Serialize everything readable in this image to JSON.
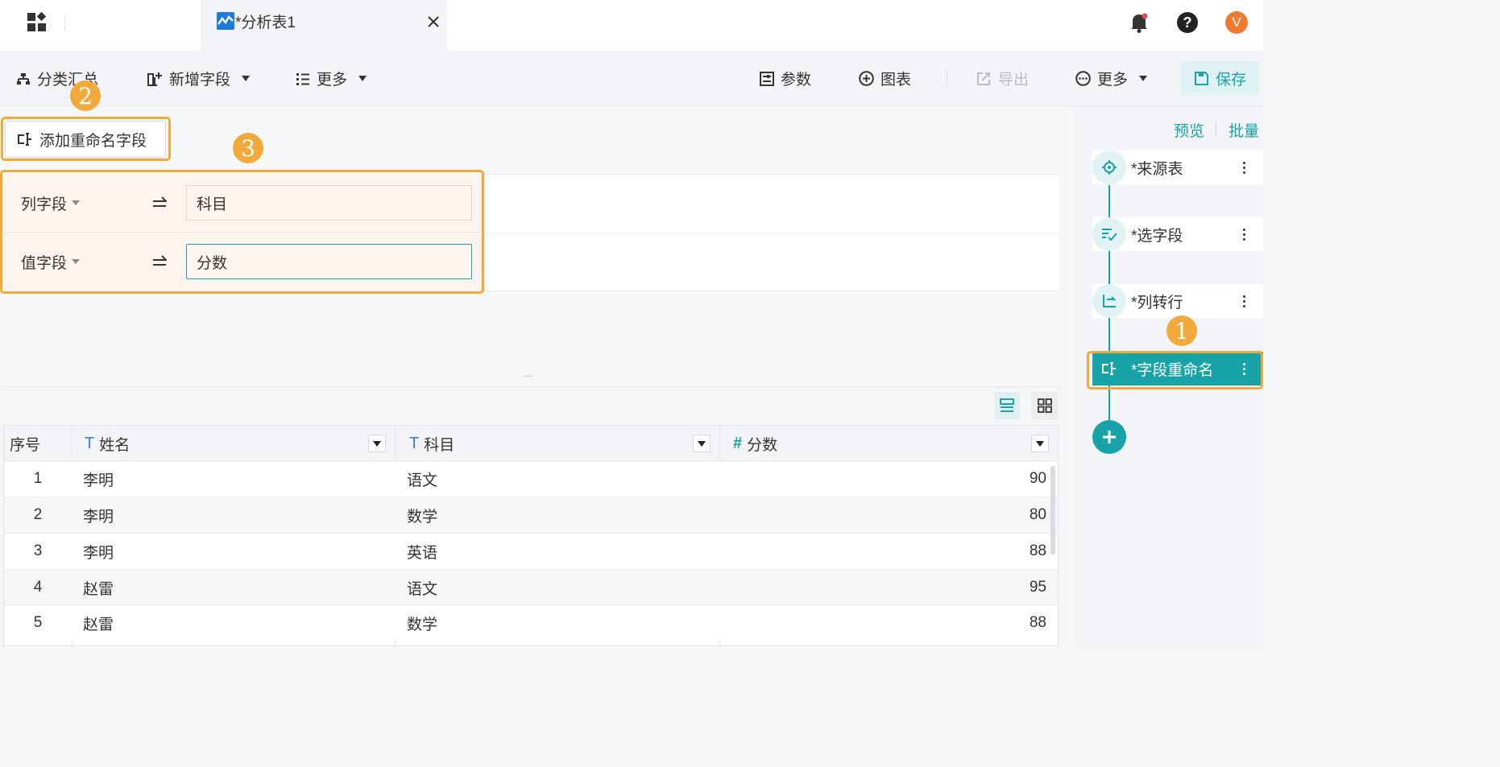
{
  "tab": {
    "title": "*分析表1"
  },
  "header": {
    "avatar_letter": "V"
  },
  "toolbar": {
    "group_summary": "分类汇总",
    "add_field": "新增字段",
    "more_left": "更多",
    "params": "参数",
    "chart": "图表",
    "export": "导出",
    "more_right": "更多",
    "save": "保存"
  },
  "editor": {
    "add_rename_button": "添加重命名字段",
    "rows": [
      {
        "field": "列字段",
        "new_name": "科目"
      },
      {
        "field": "值字段",
        "new_name": "分数"
      }
    ],
    "splitter": "..."
  },
  "steps_panel": {
    "preview": "预览",
    "batch": "批量",
    "steps": [
      {
        "label": "*来源表",
        "icon": "target-icon"
      },
      {
        "label": "*选字段",
        "icon": "select-fields-icon"
      },
      {
        "label": "*列转行",
        "icon": "unpivot-icon"
      },
      {
        "label": "*字段重命名",
        "icon": "rename-field-icon",
        "active": true
      }
    ]
  },
  "badges": {
    "b1": "1",
    "b2": "2",
    "b3": "3"
  },
  "grid": {
    "columns": [
      {
        "label": "序号",
        "type": ""
      },
      {
        "label": "姓名",
        "type": "T"
      },
      {
        "label": "科目",
        "type": "T"
      },
      {
        "label": "分数",
        "type": "#"
      }
    ],
    "rows": [
      {
        "idx": "1",
        "name": "李明",
        "subject": "语文",
        "score": "90"
      },
      {
        "idx": "2",
        "name": "李明",
        "subject": "数学",
        "score": "80"
      },
      {
        "idx": "3",
        "name": "李明",
        "subject": "英语",
        "score": "88"
      },
      {
        "idx": "4",
        "name": "赵雷",
        "subject": "语文",
        "score": "95"
      },
      {
        "idx": "5",
        "name": "赵雷",
        "subject": "数学",
        "score": "88"
      }
    ]
  },
  "colors": {
    "accent": "#17a3a8",
    "highlight": "#f2a93b",
    "notify_dot": "#e5484d",
    "avatar": "#f07a2f"
  }
}
